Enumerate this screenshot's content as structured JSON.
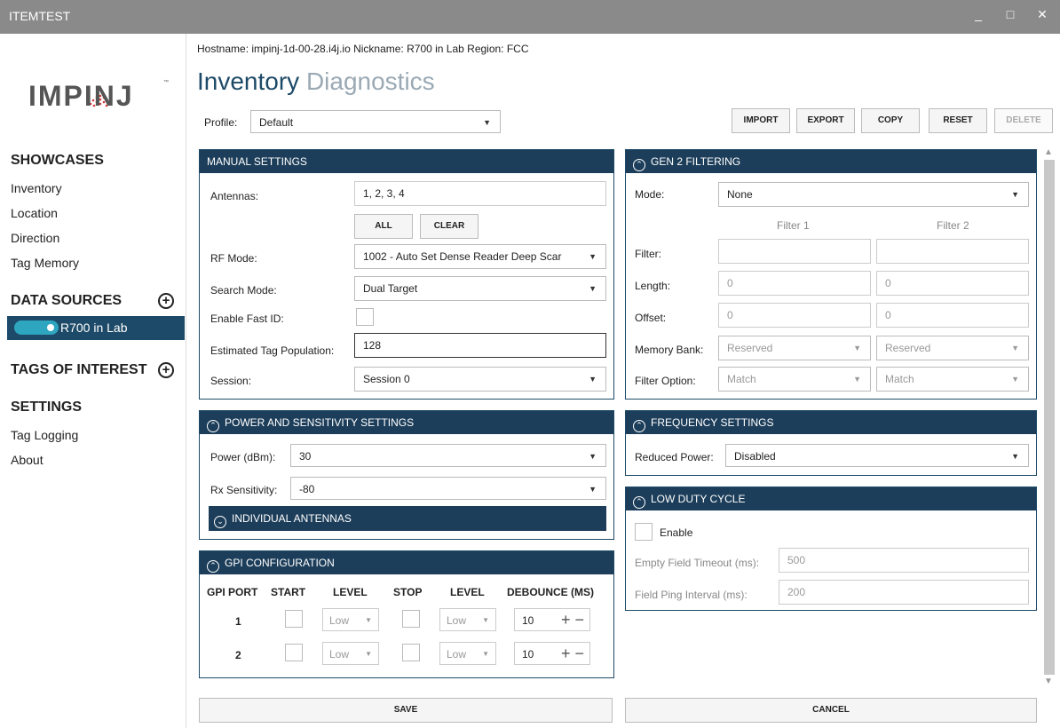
{
  "window": {
    "title": "ITEMTEST",
    "minimize": "_",
    "maximize": "□",
    "close": "✕"
  },
  "logo": {
    "text": "IMPINJ",
    "tm": "™"
  },
  "sidebar": {
    "showcases_title": "SHOWCASES",
    "showcases": [
      "Inventory",
      "Location",
      "Direction",
      "Tag Memory"
    ],
    "data_sources_title": "DATA SOURCES",
    "data_source_item": "R700 in Lab",
    "tags_title": "TAGS OF INTEREST",
    "settings_title": "SETTINGS",
    "settings": [
      "Tag Logging",
      "About"
    ]
  },
  "header": {
    "hostline": "Hostname:  impinj-1d-00-28.i4j.io   Nickname:  R700 in Lab   Region:  FCC",
    "title_active": "Inventory",
    "title_inactive": "Diagnostics",
    "profile_label": "Profile:",
    "profile_value": "Default"
  },
  "toolbar": {
    "import": "IMPORT",
    "export": "EXPORT",
    "copy": "COPY",
    "reset": "RESET",
    "delete": "DELETE"
  },
  "manual": {
    "title": "MANUAL SETTINGS",
    "antennas_label": "Antennas:",
    "antennas_value": "1, 2, 3, 4",
    "all_btn": "ALL",
    "clear_btn": "CLEAR",
    "rfmode_label": "RF Mode:",
    "rfmode_value": "1002 - Auto Set Dense Reader Deep Scar",
    "search_label": "Search Mode:",
    "search_value": "Dual Target",
    "fastid_label": "Enable Fast ID:",
    "population_label": "Estimated Tag Population:",
    "population_value": "128",
    "session_label": "Session:",
    "session_value": "Session 0"
  },
  "power": {
    "title": "POWER AND SENSITIVITY SETTINGS",
    "power_label": "Power (dBm):",
    "power_value": "30",
    "rx_label": "Rx Sensitivity:",
    "rx_value": "-80",
    "individual": "INDIVIDUAL ANTENNAS"
  },
  "gpi": {
    "title": "GPI CONFIGURATION",
    "headers": [
      "GPI PORT",
      "START",
      "LEVEL",
      "STOP",
      "LEVEL",
      "DEBOUNCE (MS)"
    ],
    "rows": [
      {
        "port": "1",
        "start_level": "Low",
        "stop_level": "Low",
        "debounce": "10"
      },
      {
        "port": "2",
        "start_level": "Low",
        "stop_level": "Low",
        "debounce": "10"
      }
    ]
  },
  "gen2": {
    "title": "GEN 2 FILTERING",
    "mode_label": "Mode:",
    "mode_value": "None",
    "filter1": "Filter 1",
    "filter2": "Filter 2",
    "filter_label": "Filter:",
    "length_label": "Length:",
    "length1": "0",
    "length2": "0",
    "offset_label": "Offset:",
    "offset1": "0",
    "offset2": "0",
    "bank_label": "Memory Bank:",
    "bank1": "Reserved",
    "bank2": "Reserved",
    "option_label": "Filter Option:",
    "option1": "Match",
    "option2": "Match"
  },
  "frequency": {
    "title": "FREQUENCY SETTINGS",
    "reduced_label": "Reduced Power:",
    "reduced_value": "Disabled"
  },
  "duty": {
    "title": "LOW DUTY CYCLE",
    "enable_label": "Enable",
    "empty_label": "Empty Field Timeout (ms):",
    "empty_value": "500",
    "ping_label": "Field Ping Interval (ms):",
    "ping_value": "200"
  },
  "footer": {
    "save": "SAVE",
    "cancel": "CANCEL"
  }
}
